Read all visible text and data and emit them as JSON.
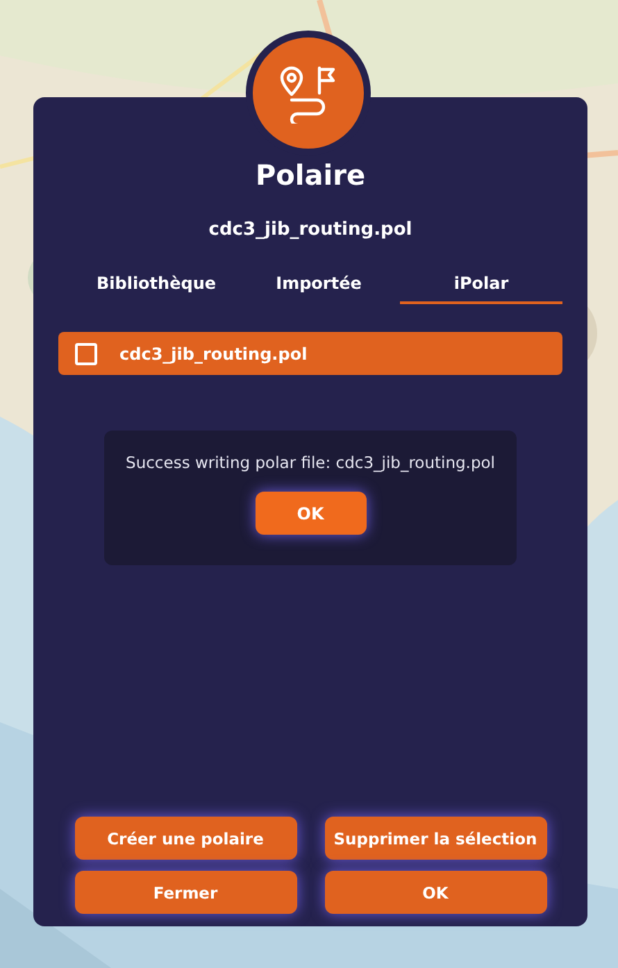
{
  "dialog": {
    "title": "Polaire",
    "subtitle": "cdc3_jib_routing.pol"
  },
  "tabs": [
    {
      "label": "Bibliothèque",
      "selected": false
    },
    {
      "label": "Importée",
      "selected": false
    },
    {
      "label": "iPolar",
      "selected": true
    }
  ],
  "files": [
    {
      "name": "cdc3_jib_routing.pol",
      "checked": false
    }
  ],
  "alert": {
    "message": "Success writing polar file: cdc3_jib_routing.pol",
    "button": "OK"
  },
  "buttons": [
    "Créer une polaire",
    "Supprimer la sélection",
    "Fermer",
    "OK"
  ]
}
